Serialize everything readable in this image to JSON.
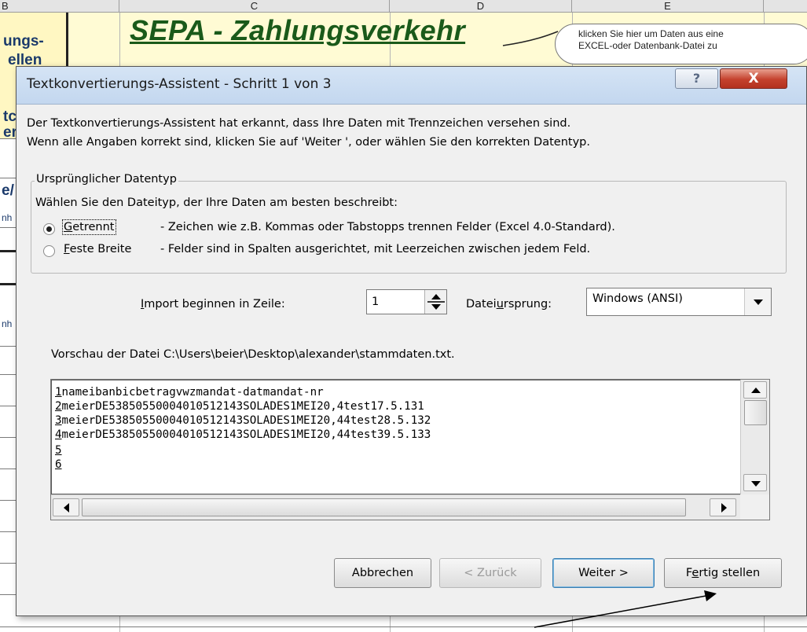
{
  "sheet": {
    "columns": [
      "B",
      "C",
      "D",
      "E"
    ],
    "left_fragments": [
      "ungs-",
      "ellen",
      "tc",
      "er",
      "e/",
      "nh",
      "nh"
    ],
    "banner_title": "SEPA - Zahlungsverkehr",
    "callout_line1": "klicken Sie hier um Daten aus eine",
    "callout_line2": "EXCEL-oder Datenbank-Datei zu"
  },
  "dialog": {
    "title": "Textkonvertierungs-Assistent - Schritt 1 von 3",
    "help_label": "?",
    "close_label": "X",
    "intro_line1": "Der Textkonvertierungs-Assistent hat erkannt, dass Ihre Daten mit Trennzeichen versehen sind.",
    "intro_line2": "Wenn alle Angaben korrekt sind, klicken Sie auf 'Weiter ', oder wählen Sie den korrekten Datentyp.",
    "group_title": "Ursprünglicher Datentyp",
    "group_prompt": "Wählen Sie den Dateityp, der Ihre Daten am besten beschreibt:",
    "option1": {
      "label_accel": "G",
      "label_rest": "etrennt",
      "description": "- Zeichen wie z.B. Kommas oder Tabstopps trennen Felder (Excel 4.0-Standard).",
      "selected": true
    },
    "option2": {
      "label_accel": "F",
      "label_rest": "este Breite",
      "description": "- Felder sind in Spalten ausgerichtet, mit Leerzeichen zwischen jedem Feld.",
      "selected": false
    },
    "start_row_label_accel": "I",
    "start_row_label_rest": "mport beginnen in Zeile:",
    "start_row_value": "1",
    "origin_label_pre": "Datei",
    "origin_label_accel": "u",
    "origin_label_post": "rsprung:",
    "origin_value": "Windows (ANSI)",
    "preview_label": "Vorschau der Datei C:\\Users\\beier\\Desktop\\alexander\\stammdaten.txt.",
    "preview_lines": [
      {
        "num": "1",
        "text": "nameibanbicbetragvwzmandat-datmandat-nr"
      },
      {
        "num": "2",
        "text": "meierDE53850550004010512143SOLADES1MEI20,4test17.5.131"
      },
      {
        "num": "3",
        "text": "meierDE53850550004010512143SOLADES1MEI20,44test28.5.132"
      },
      {
        "num": "4",
        "text": "meierDE53850550004010512143SOLADES1MEI20,44test39.5.133"
      },
      {
        "num": "5",
        "text": ""
      },
      {
        "num": "6",
        "text": ""
      }
    ],
    "buttons": {
      "cancel": "Abbrechen",
      "back": "< Zurück",
      "next": "Weiter >",
      "finish_pre": "F",
      "finish_accel": "e",
      "finish_post": "rtig stellen"
    }
  }
}
